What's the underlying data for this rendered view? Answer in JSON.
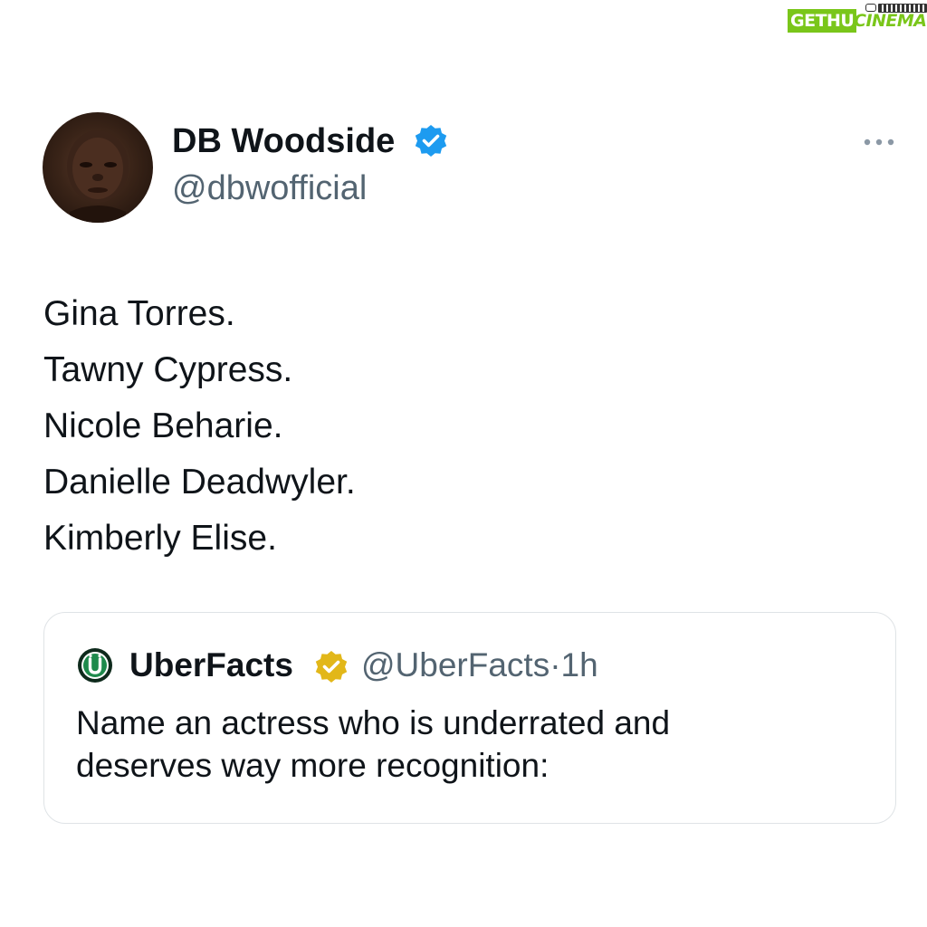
{
  "watermark": {
    "part1": "GETHU",
    "part2": "CINEMA"
  },
  "tweet": {
    "author": {
      "display_name": "DB Woodside",
      "handle": "@dbwofficial",
      "verified": "blue"
    },
    "lines": [
      "Gina Torres.",
      "Tawny Cypress.",
      "Nicole Beharie.",
      "Danielle Deadwyler.",
      "Kimberly Elise."
    ]
  },
  "quoted_tweet": {
    "display_name": "UberFacts",
    "handle": "@UberFacts",
    "separator": "·",
    "time": "1h",
    "verified": "gold",
    "text_line1": "Name an actress who is underrated and",
    "text_line2": "deserves way more recognition:"
  },
  "colors": {
    "verified_blue": "#1d9bf0",
    "verified_gold": "#e2b719",
    "secondary_text": "#536471",
    "watermark_green": "#7ac61a"
  }
}
